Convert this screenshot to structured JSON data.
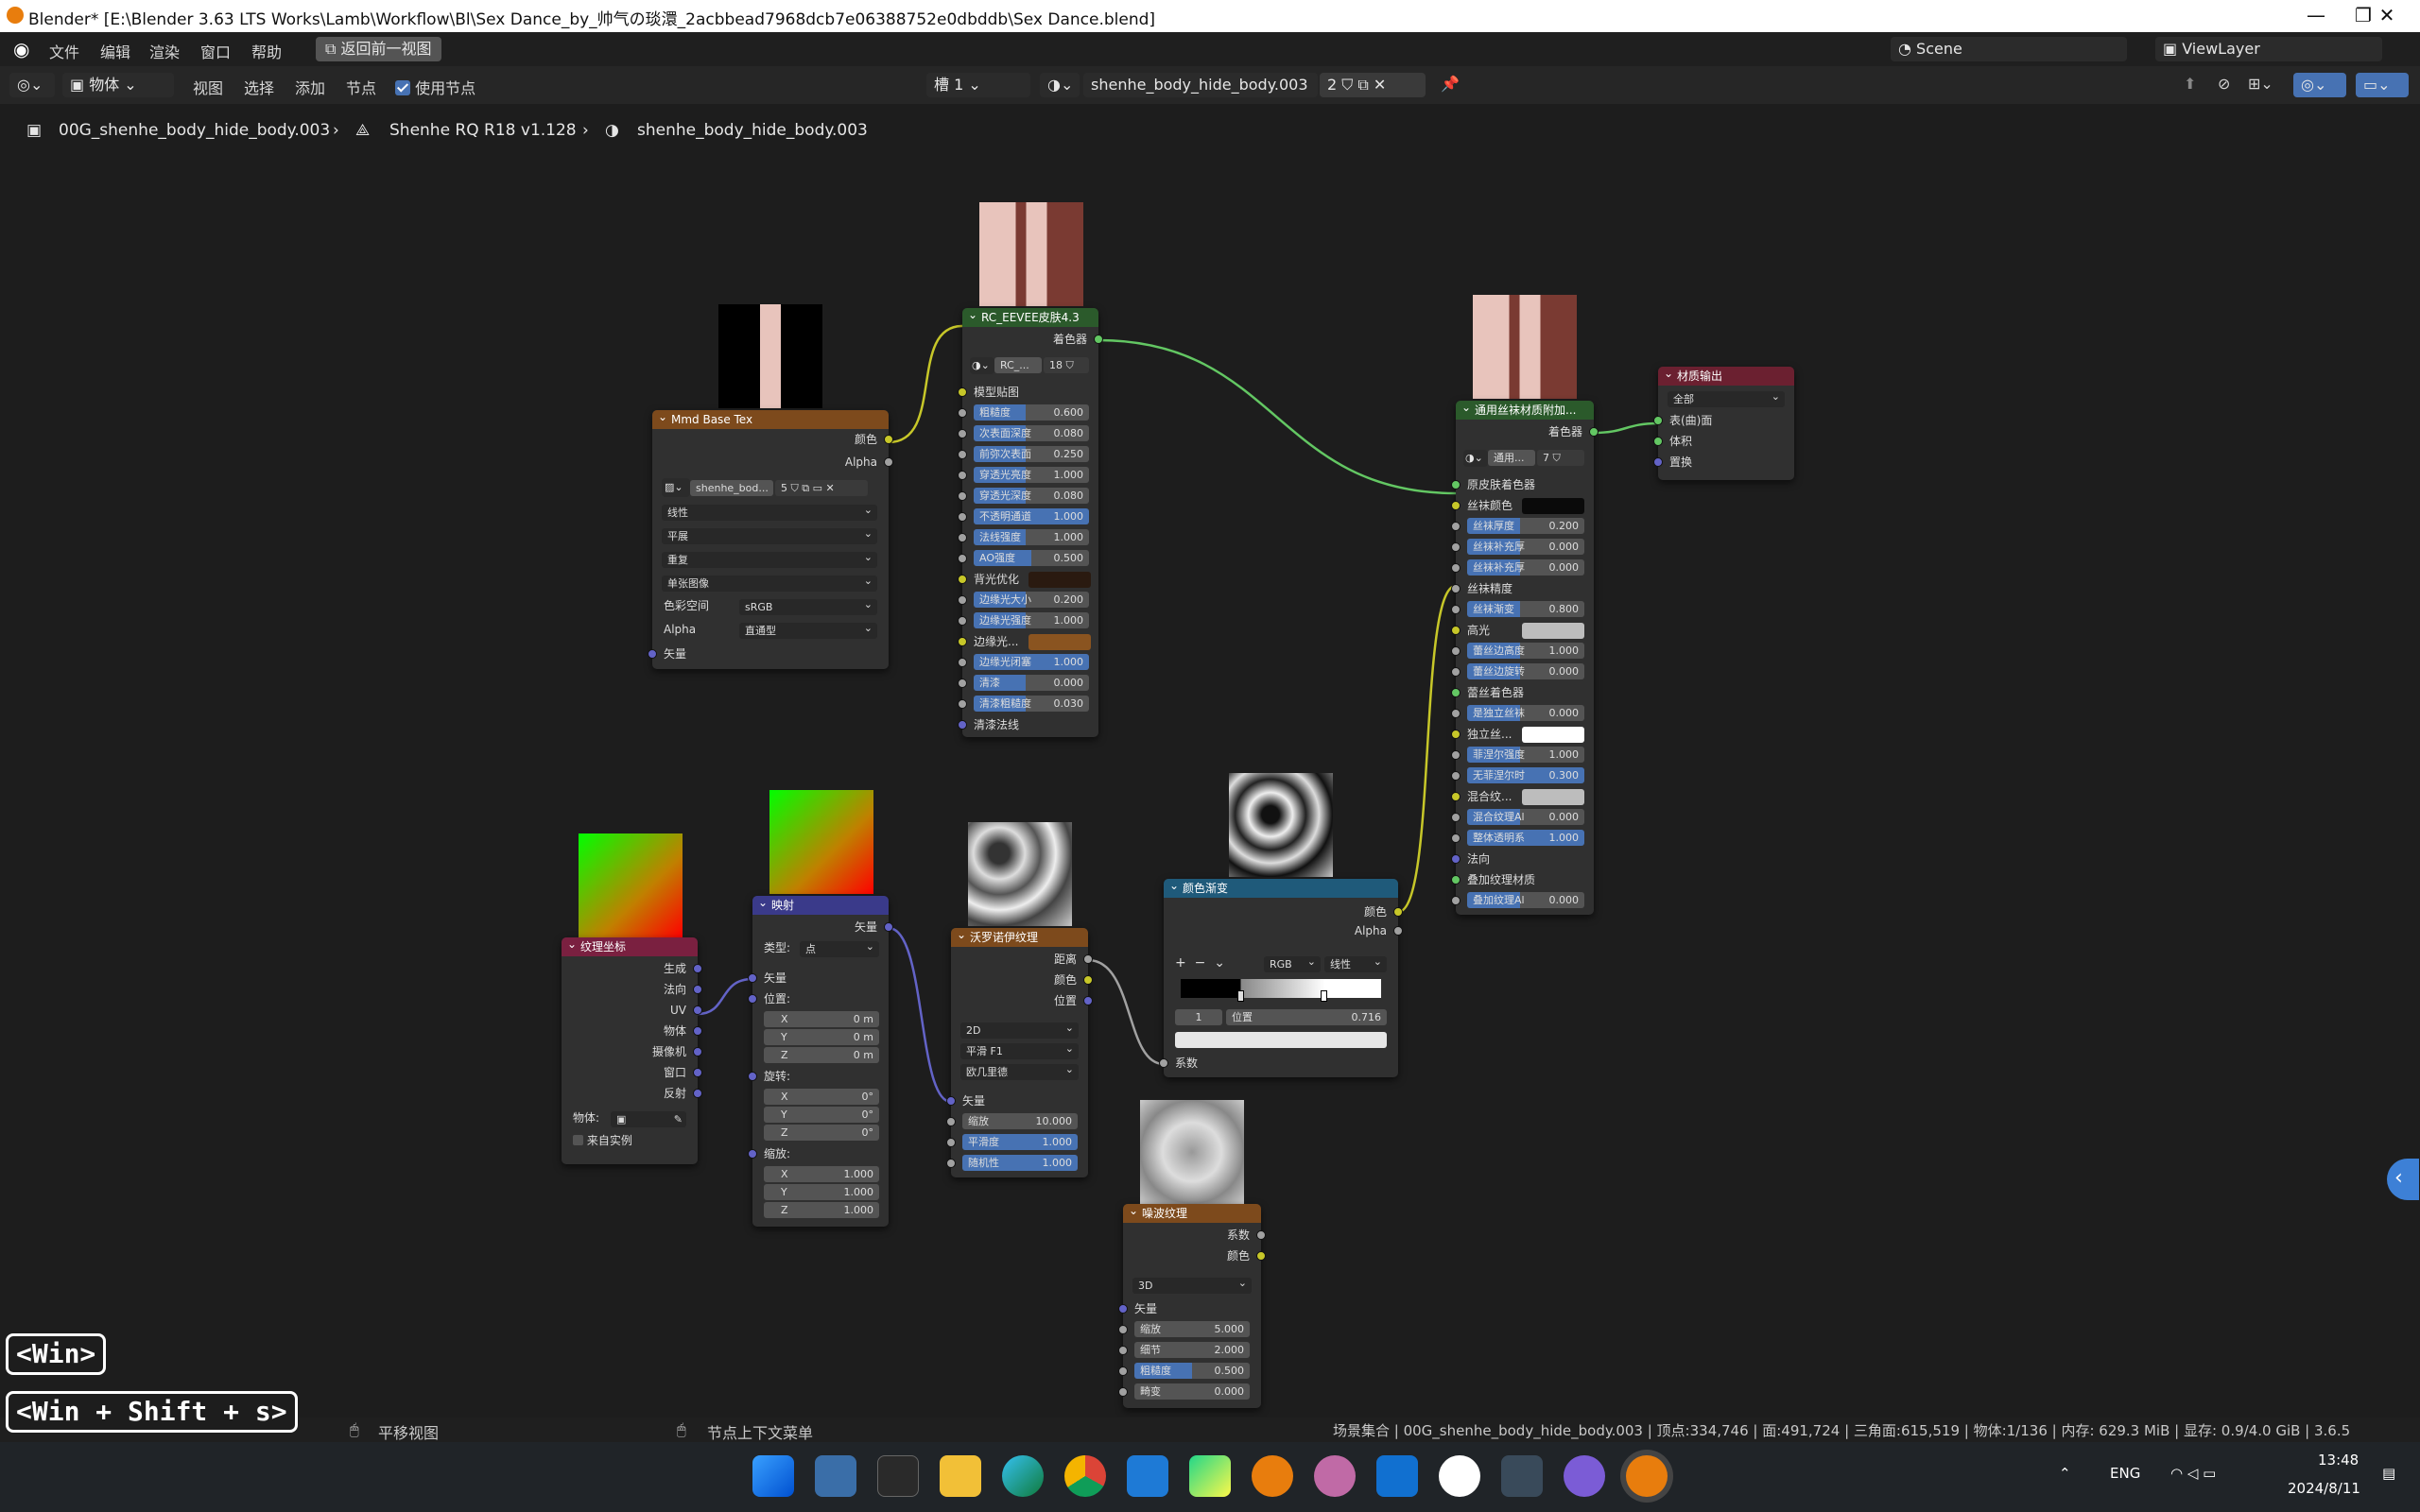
{
  "window": {
    "title": "Blender* [E:\\Blender 3.63 LTS Works\\Lamb\\Workflow\\Bl\\Sex Dance_by_帅气の琰澴_2acbbead7968dcb7e06388752e0dbddb\\Sex Dance.blend]",
    "minimize": "—",
    "maximize": "❐",
    "close": "✕"
  },
  "menu": {
    "file": "文件",
    "edit": "编辑",
    "render": "渲染",
    "window": "窗口",
    "help": "帮助",
    "back": "返回前一视图",
    "scene": "Scene",
    "viewlayer": "ViewLayer"
  },
  "header": {
    "mode": "物体",
    "view": "视图",
    "select": "选择",
    "add": "添加",
    "node": "节点",
    "use_nodes": "使用节点",
    "slot": "槽 1",
    "material": "shenhe_body_hide_body.003",
    "users": "2"
  },
  "breadcrumb": {
    "object": "00G_shenhe_body_hide_body.003",
    "mesh": "Shenhe RQ R18 v1.128",
    "material": "shenhe_body_hide_body.003"
  },
  "nodes": {
    "base_tex": {
      "title": "Mmd Base Tex",
      "out_color": "颜色",
      "out_alpha": "Alpha",
      "image": "shenhe_bod...",
      "image_users": "5",
      "interp": "线性",
      "proj": "平展",
      "ext": "重复",
      "src": "单张图像",
      "cs_label": "色彩空间",
      "cs": "sRGB",
      "alpha_label": "Alpha",
      "alpha": "直通型",
      "in_vec": "矢量"
    },
    "eevee": {
      "title": "RC_EEVEE皮肤4.3",
      "out": "着色器",
      "group": "RC_...",
      "group_users": "18",
      "model_tex": "模型贴图",
      "fields": [
        {
          "label": "粗糙度",
          "value": "0.600",
          "pct": "45%"
        },
        {
          "label": "次表面深度",
          "value": "0.080",
          "pct": "45%"
        },
        {
          "label": "前弥次表面",
          "value": "0.250",
          "pct": "45%"
        },
        {
          "label": "穿透光亮度",
          "value": "1.000",
          "pct": "45%"
        },
        {
          "label": "穿透光深度",
          "value": "0.080",
          "pct": "45%"
        },
        {
          "label": "不透明通道",
          "value": "1.000",
          "pct": "100%"
        },
        {
          "label": "法线强度",
          "value": "1.000",
          "pct": "45%"
        },
        {
          "label": "AO强度",
          "value": "0.500",
          "pct": "50%"
        }
      ],
      "backlight": "背光优化",
      "fields2": [
        {
          "label": "边缘光大小",
          "value": "0.200",
          "pct": "45%"
        },
        {
          "label": "边缘光强度",
          "value": "1.000",
          "pct": "45%"
        }
      ],
      "rim_color": "边缘光...",
      "fields3": [
        {
          "label": "边缘光闭塞",
          "value": "1.000",
          "pct": "100%"
        },
        {
          "label": "清漆",
          "value": "0.000",
          "pct": "45%"
        },
        {
          "label": "清漆粗糙度",
          "value": "0.030",
          "pct": "45%"
        }
      ],
      "cc_normal": "清漆法线"
    },
    "stocking": {
      "title": "通用丝袜材质附加...",
      "out": "着色器",
      "group": "通用...",
      "group_users": "7",
      "skin": "原皮肤着色器",
      "stock_color": "丝袜颜色",
      "fields": [
        {
          "label": "丝袜厚度",
          "value": "0.200",
          "pct": "45%"
        },
        {
          "label": "丝袜补充厚",
          "value": "0.000",
          "pct": "45%"
        },
        {
          "label": "丝袜补充厚",
          "value": "0.000",
          "pct": "45%"
        }
      ],
      "precision": "丝袜精度",
      "fields2": [
        {
          "label": "丝袜渐变",
          "value": "0.800",
          "pct": "45%"
        }
      ],
      "highlight": "高光",
      "fields3": [
        {
          "label": "蕾丝边高度",
          "value": "1.000",
          "pct": "45%"
        },
        {
          "label": "蕾丝边旋转",
          "value": "0.000",
          "pct": "45%"
        }
      ],
      "lace": "蕾丝着色器",
      "fields4": [
        {
          "label": "是独立丝袜",
          "value": "0.000",
          "pct": "45%"
        }
      ],
      "indep": "独立丝...",
      "fields5": [
        {
          "label": "菲涅尔强度",
          "value": "1.000",
          "pct": "45%"
        },
        {
          "label": "无菲涅尔时",
          "value": "0.300",
          "pct": "100%"
        }
      ],
      "mix": "混合纹...",
      "fields6": [
        {
          "label": "混合纹理Al",
          "value": "0.000",
          "pct": "45%"
        },
        {
          "label": "整体透明系",
          "value": "1.000",
          "pct": "100%"
        }
      ],
      "normal": "法向",
      "overlay": "叠加纹理材质",
      "fields7": [
        {
          "label": "叠加纹理Al",
          "value": "0.000",
          "pct": "45%"
        }
      ]
    },
    "output": {
      "title": "材质输出",
      "target": "全部",
      "surface": "表(曲)面",
      "volume": "体积",
      "disp": "置换"
    },
    "texcoord": {
      "title": "纹理坐标",
      "outs": [
        "生成",
        "法向",
        "UV",
        "物体",
        "摄像机",
        "窗口",
        "反射"
      ],
      "obj": "物体:",
      "inst": "来自实例"
    },
    "mapping": {
      "title": "映射",
      "out": "矢量",
      "type_label": "类型:",
      "type": "点",
      "in": "矢量",
      "loc": "位置:",
      "rot": "旋转:",
      "scale": "缩放:",
      "loc_v": [
        {
          "a": "X",
          "v": "0 m"
        },
        {
          "a": "Y",
          "v": "0 m"
        },
        {
          "a": "Z",
          "v": "0 m"
        }
      ],
      "rot_v": [
        {
          "a": "X",
          "v": "0°"
        },
        {
          "a": "Y",
          "v": "0°"
        },
        {
          "a": "Z",
          "v": "0°"
        }
      ],
      "scl_v": [
        {
          "a": "X",
          "v": "1.000"
        },
        {
          "a": "Y",
          "v": "1.000"
        },
        {
          "a": "Z",
          "v": "1.000"
        }
      ]
    },
    "voronoi": {
      "title": "沃罗诺伊纹理",
      "outs": [
        "距离",
        "颜色",
        "位置"
      ],
      "dim": "2D",
      "feature": "平滑 F1",
      "metric": "欧几里德",
      "in": "矢量",
      "fields": [
        {
          "label": "缩放",
          "value": "10.000",
          "pct": "0%"
        },
        {
          "label": "平滑度",
          "value": "1.000",
          "pct": "100%"
        },
        {
          "label": "随机性",
          "value": "1.000",
          "pct": "100%"
        }
      ]
    },
    "ramp": {
      "title": "颜色渐变",
      "out_color": "颜色",
      "out_alpha": "Alpha",
      "mode": "RGB",
      "interp": "线性",
      "idx": "1",
      "pos_label": "位置",
      "pos": "0.716",
      "fac": "系数"
    },
    "noise": {
      "title": "噪波纹理",
      "outs": [
        "系数",
        "颜色"
      ],
      "dim": "3D",
      "in": "矢量",
      "fields": [
        {
          "label": "缩放",
          "value": "5.000",
          "pct": "0%"
        },
        {
          "label": "细节",
          "value": "2.000",
          "pct": "0%"
        },
        {
          "label": "粗糙度",
          "value": "0.500",
          "pct": "50%"
        },
        {
          "label": "畸变",
          "value": "0.000",
          "pct": "0%"
        }
      ]
    }
  },
  "status": {
    "pan": "平移视图",
    "ctx": "节点上下文菜单",
    "info": "场景集合 | 00G_shenhe_body_hide_body.003 | 顶点:334,746 | 面:491,724 | 三角面:615,519 | 物体:1/136 | 内存: 629.3 MiB | 显存: 0.9/4.0 GiB | 3.6.5"
  },
  "overlay": {
    "k1": "<Win>",
    "k2": "<Win + Shift + s>"
  },
  "tray": {
    "lang": "ENG",
    "time": "13:48",
    "date": "2024/8/11"
  }
}
